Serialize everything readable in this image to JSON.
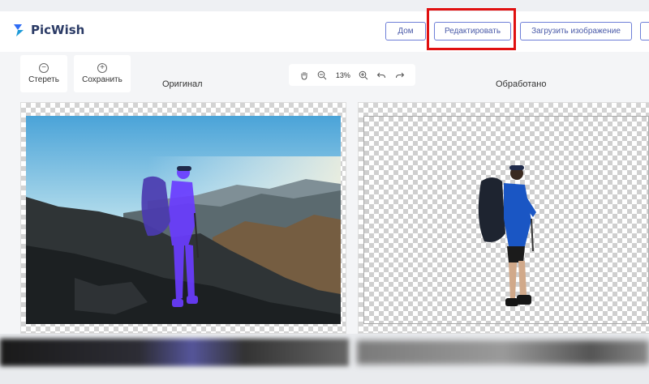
{
  "header": {
    "brand": "PicWish",
    "nav": {
      "home": "Дом",
      "edit": "Редактировать",
      "upload": "Загрузить изображение"
    }
  },
  "tools": {
    "erase": "Стереть",
    "save": "Сохранить"
  },
  "zoom": {
    "value": "13%"
  },
  "panels": {
    "original_label": "Оригинал",
    "processed_label": "Обработано"
  },
  "colors": {
    "accent": "#4a5aa8",
    "highlight": "#e01010",
    "selection": "#6a3cff"
  }
}
